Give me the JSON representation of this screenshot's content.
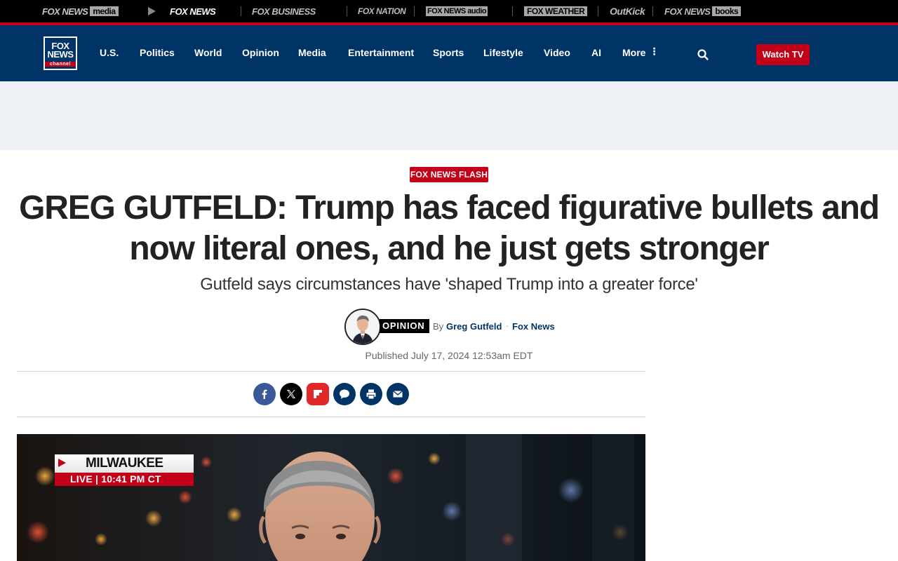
{
  "network": {
    "items": [
      {
        "label": "FOX NEWS",
        "suffix": "media"
      },
      {
        "label": "FOX NEWS"
      },
      {
        "label": "FOX BUSINESS"
      },
      {
        "label": "FOX NATION"
      },
      {
        "label": "FOX NEWS",
        "suffix": "audio"
      },
      {
        "label": "FOX WEATHER"
      },
      {
        "label": "OutKick"
      },
      {
        "label": "FOX NEWS",
        "suffix": "books"
      }
    ]
  },
  "header": {
    "logo": {
      "line1": "FOX",
      "line2": "NEWS",
      "line3": "channel"
    },
    "nav": [
      "U.S.",
      "Politics",
      "World",
      "Opinion",
      "Media",
      "Entertainment",
      "Sports",
      "Lifestyle",
      "Video",
      "AI",
      "More"
    ],
    "watch_tv": "Watch TV"
  },
  "article": {
    "badge": "FOX NEWS FLASH",
    "headline": "GREG GUTFELD: Trump has faced figurative bullets and now literal ones, and he just gets stronger",
    "subheadline": "Gutfeld says circumstances have 'shaped Trump into a greater force'",
    "category_tag": "OPINION",
    "by": "By",
    "author": "Greg Gutfeld",
    "separator": "·",
    "outlet": "Fox News",
    "published": "Published July 17, 2024 12:53am EDT"
  },
  "video": {
    "location": "MILWAUKEE",
    "live_text": "LIVE | 10:41 PM CT"
  },
  "colors": {
    "navy": "#003366",
    "red": "#c20017",
    "facebook": "#3b5998",
    "flipboard": "#e12828"
  }
}
